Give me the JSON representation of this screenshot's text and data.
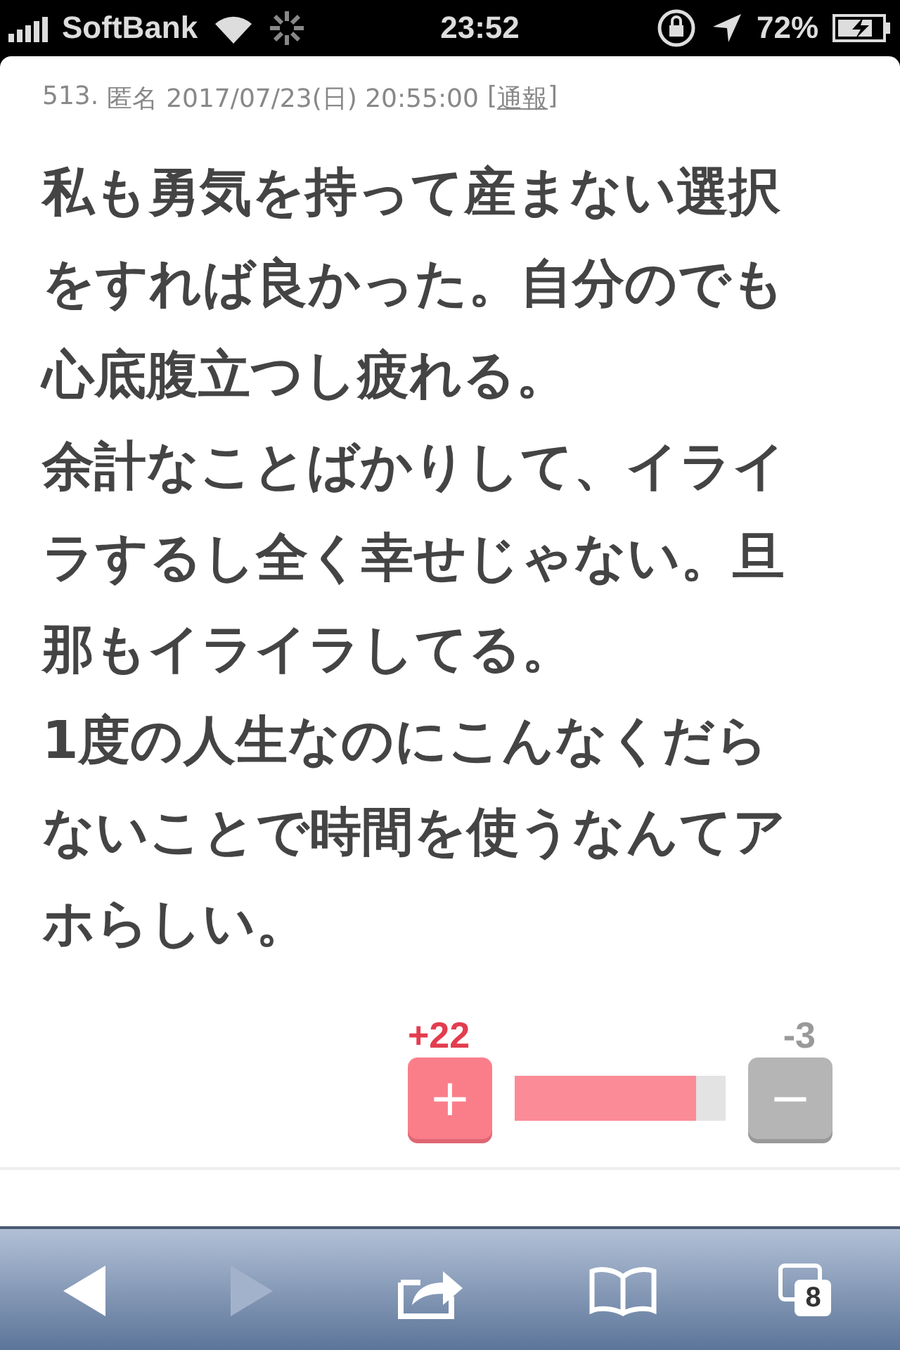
{
  "status_bar": {
    "carrier": "SoftBank",
    "time": "23:52",
    "battery": "72%"
  },
  "comment": {
    "number": "513.",
    "author": "匿名",
    "date": "2017/07/23(日) 20:55:00",
    "report_open": "[",
    "report": "通報",
    "report_close": "]",
    "lines": [
      "私も勇気を持って産まない選択",
      "をすれば良かった。自分のでも",
      "心底腹立つし疲れる。",
      "余計なことばかりして、イライ",
      "ラするし全く幸せじゃない。旦",
      "那もイライラしてる。",
      "1度の人生なのにこんなくだら",
      "ないことで時間を使うなんてア",
      "ホらしい。"
    ]
  },
  "votes": {
    "plus_count": "+22",
    "minus_count": "-3",
    "plus_label": "+",
    "minus_label": "−",
    "level": 0.86
  },
  "toolbar": {
    "tabs_count": "8",
    "back_disabled": false,
    "forward_disabled": true
  }
}
